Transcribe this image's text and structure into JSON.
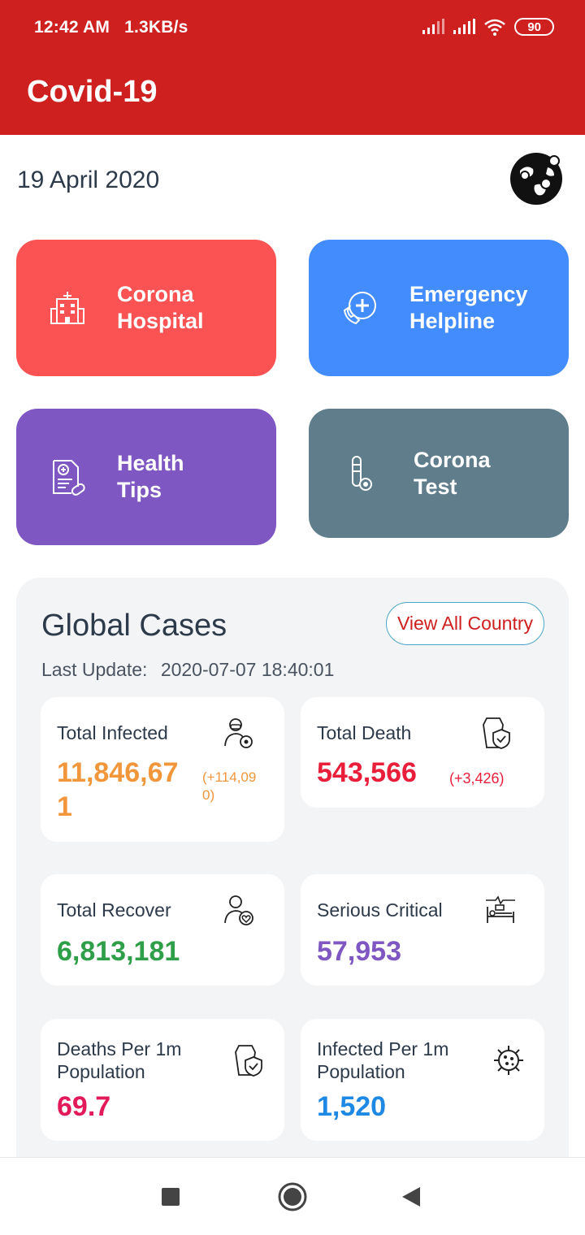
{
  "status_bar": {
    "time": "12:42 AM",
    "speed": "1.3KB/s",
    "battery": "90"
  },
  "app": {
    "title": "Covid-19"
  },
  "date": "19 April 2020",
  "cards": {
    "hospital": {
      "label_line1": "Corona",
      "label_line2": "Hospital"
    },
    "helpline": {
      "label_line1": "Emergency",
      "label_line2": "Helpline"
    },
    "tips": {
      "label_line1": "Health",
      "label_line2": "Tips"
    },
    "test": {
      "label_line1": "Corona",
      "label_line2": "Test"
    }
  },
  "global": {
    "title": "Global Cases",
    "button": "View All Country",
    "last_update_label": "Last Update:",
    "last_update_value": "2020-07-07 18:40:01",
    "stats": {
      "infected": {
        "label": "Total Infected",
        "value_line1": "11,846,67",
        "value_line2": "1",
        "delta_line1": "(+114,09",
        "delta_line2": "0)",
        "color": "#f1963a"
      },
      "death": {
        "label": "Total Death",
        "value": "543,566",
        "delta": "(+3,426)",
        "color": "#e91e3a"
      },
      "recover": {
        "label": "Total Recover",
        "value": "6,813,181",
        "color": "#2e9e48"
      },
      "critical": {
        "label": "Serious Critical",
        "value": "57,953",
        "color": "#7e57c2"
      },
      "deaths_per_1m": {
        "label_line1": "Deaths Per 1m",
        "label_line2": "Population",
        "value": "69.7",
        "color": "#e21a5a"
      },
      "infected_per_1m": {
        "label_line1": "Infected Per 1m",
        "label_line2": "Population",
        "value": "1,520",
        "color": "#1e88e5"
      }
    }
  },
  "icons": {
    "hospital": "hospital-icon",
    "helpline": "phone-plus-icon",
    "tips": "document-pill-icon",
    "test": "test-tube-icon",
    "globe": "globe-virus-icon",
    "infected": "masked-person-icon",
    "death": "coffin-shield-icon",
    "recover": "person-heart-icon",
    "critical": "hospital-bed-icon",
    "per1m_death": "coffin-shield-icon",
    "per1m_infected": "virus-icon"
  }
}
